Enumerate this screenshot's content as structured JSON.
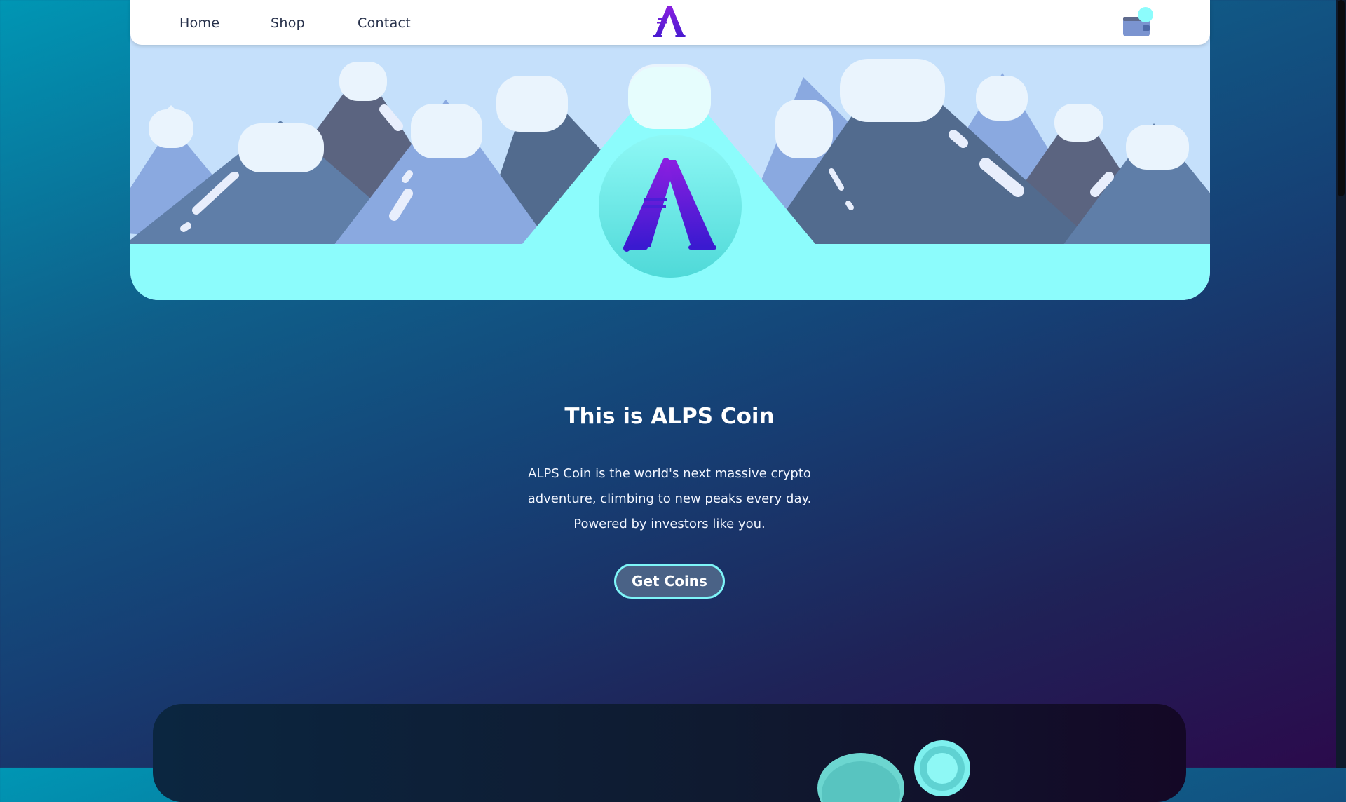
{
  "nav": {
    "links": [
      {
        "label": "Home"
      },
      {
        "label": "Shop"
      },
      {
        "label": "Contact"
      }
    ],
    "logo_icon": "alps-coin-logo-icon",
    "wallet_icon": "wallet-icon"
  },
  "hero": {
    "coin_icon": "alps-coin-icon",
    "scene": "mountains-illustration"
  },
  "intro": {
    "title": "This is ALPS Coin",
    "lines": [
      "ALPS Coin is the world's next massive crypto",
      "adventure, climbing to new peaks every day.",
      "Powered by investors like you."
    ],
    "cta_label": "Get Coins"
  },
  "colors": {
    "accent_cyan": "#8cfcfc",
    "logo_purple": "#6a1fd6",
    "nav_text": "#26304a"
  }
}
